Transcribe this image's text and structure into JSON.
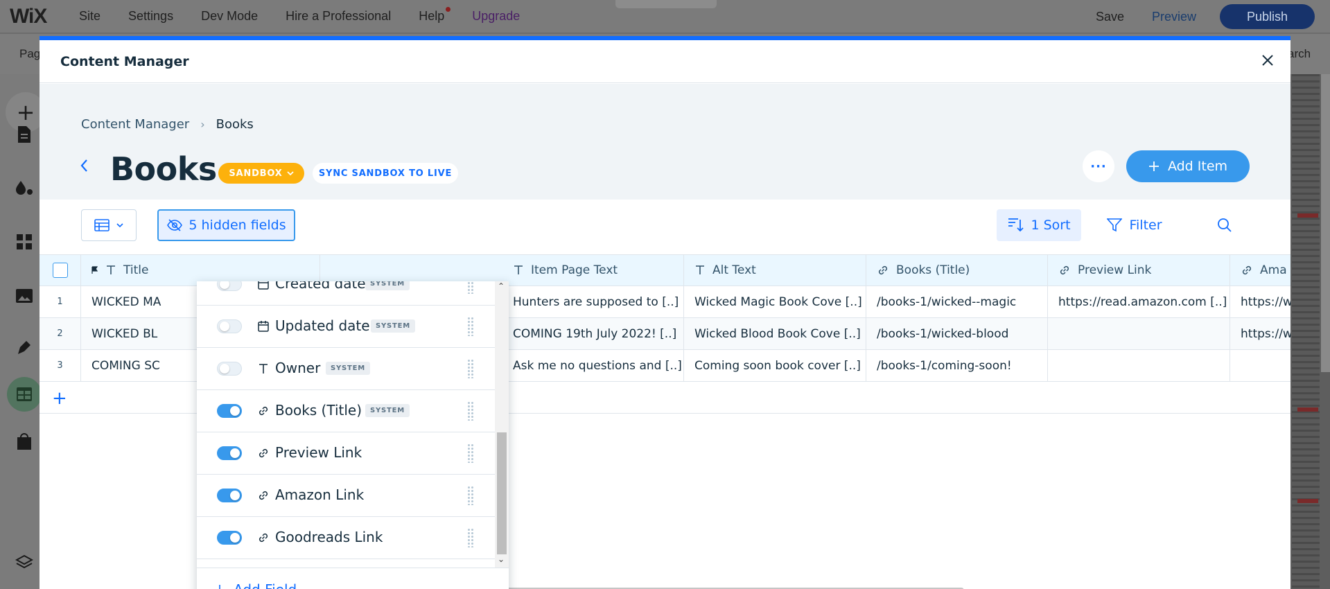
{
  "editor": {
    "logo": "WiX",
    "nav": [
      "Site",
      "Settings",
      "Dev Mode",
      "Hire a Professional",
      "Help",
      "Upgrade"
    ],
    "save": "Save",
    "preview": "Preview",
    "publish": "Publish",
    "second_bar_left": "Pag",
    "second_bar_right": "arch"
  },
  "modal": {
    "title": "Content Manager",
    "breadcrumb": [
      "Content Manager",
      "Books"
    ],
    "collection_title": "Books",
    "sandbox_badge": "SANDBOX",
    "sync_badge": "SYNC SANDBOX TO LIVE",
    "more_label": "···",
    "add_item": "Add Item"
  },
  "toolbar": {
    "hidden_fields": "5 hidden fields",
    "sort": "1 Sort",
    "filter": "Filter"
  },
  "table": {
    "columns": [
      {
        "label": "Title",
        "icon": "text-icon"
      },
      {
        "label": "Item Page Text",
        "icon": "text-icon"
      },
      {
        "label": "Alt Text",
        "icon": "text-icon"
      },
      {
        "label": "Books (Title)",
        "icon": "link-icon"
      },
      {
        "label": "Preview Link",
        "icon": "link-icon"
      },
      {
        "label": "Ama",
        "icon": "link-icon"
      }
    ],
    "rows": [
      {
        "num": "1",
        "title": "WICKED MA",
        "item_page_text": "Hunters are supposed to  [..]",
        "alt_text": "Wicked Magic Book Cove [..]",
        "books_title": "/books-1/wicked--magic",
        "preview_link": "https://read.amazon.com [..]",
        "amazon": "https://w"
      },
      {
        "num": "2",
        "title": "WICKED BL",
        "item_page_text": "COMING 19th July 2022!  [..]",
        "alt_text": "Wicked Blood Book Cove [..]",
        "books_title": "/books-1/wicked-blood",
        "preview_link": "",
        "amazon": "https://w"
      },
      {
        "num": "3",
        "title": "COMING SC",
        "item_page_text": "Ask me no questions and  [..]",
        "alt_text": "Coming soon book cover  [..]",
        "books_title": "/books-1/coming-soon!",
        "preview_link": "",
        "amazon": ""
      }
    ]
  },
  "hidden_fields_popover": {
    "fields": [
      {
        "name": "Created date",
        "icon": "calendar-icon",
        "system": "SYSTEM",
        "visible": false
      },
      {
        "name": "Updated date",
        "icon": "calendar-icon",
        "system": "SYSTEM",
        "visible": false
      },
      {
        "name": "Owner",
        "icon": "text-icon",
        "system": "SYSTEM",
        "visible": false
      },
      {
        "name": "Books (Title)",
        "icon": "link-icon",
        "system": "SYSTEM",
        "visible": true
      },
      {
        "name": "Preview Link",
        "icon": "link-icon",
        "system": "",
        "visible": true
      },
      {
        "name": "Amazon Link",
        "icon": "link-icon",
        "system": "",
        "visible": true
      },
      {
        "name": "Goodreads Link",
        "icon": "link-icon",
        "system": "",
        "visible": true
      }
    ],
    "add_field": "Add Field"
  },
  "colors": {
    "accent": "#116dff",
    "sandbox": "#fdb10c",
    "header_bg": "#f0f4f7",
    "table_header_bg": "#eaf7ff"
  }
}
